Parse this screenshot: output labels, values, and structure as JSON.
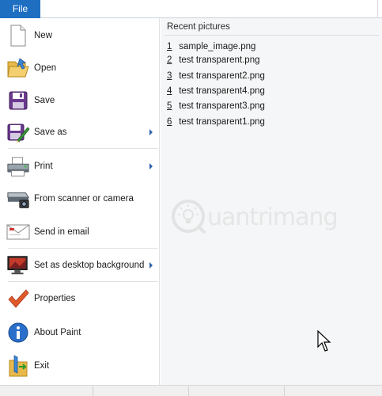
{
  "file_tab": {
    "label": "File"
  },
  "menu": {
    "items": [
      {
        "label": "New",
        "icon": "new-document-icon",
        "has_submenu": false
      },
      {
        "label": "Open",
        "icon": "open-folder-icon",
        "has_submenu": false
      },
      {
        "label": "Save",
        "icon": "floppy-disk-icon",
        "has_submenu": false
      },
      {
        "label": "Save as",
        "icon": "save-as-icon",
        "has_submenu": true
      },
      {
        "label": "Print",
        "icon": "printer-icon",
        "has_submenu": true
      },
      {
        "label": "From scanner or camera",
        "icon": "scanner-camera-icon",
        "has_submenu": false
      },
      {
        "label": "Send in email",
        "icon": "email-icon",
        "has_submenu": false
      },
      {
        "label": "Set as desktop background",
        "icon": "desktop-monitor-icon",
        "has_submenu": true
      },
      {
        "label": "Properties",
        "icon": "checkmark-icon",
        "has_submenu": false
      },
      {
        "label": "About Paint",
        "icon": "info-icon",
        "has_submenu": false
      },
      {
        "label": "Exit",
        "icon": "exit-icon",
        "has_submenu": false
      }
    ]
  },
  "recent": {
    "title": "Recent pictures",
    "items": [
      {
        "num": "1",
        "name": "sample_image.png"
      },
      {
        "num": "2",
        "name": "test transparent.png"
      },
      {
        "num": "3",
        "name": "test transparent2.png"
      },
      {
        "num": "4",
        "name": "test transparent4.png"
      },
      {
        "num": "5",
        "name": "test transparent3.png"
      },
      {
        "num": "6",
        "name": "test transparent1.png"
      }
    ]
  },
  "watermark": {
    "text": "uantrimang"
  },
  "colors": {
    "file_tab": "#1e6fc2",
    "recent_bg": "#f5f6f7",
    "submenu_arrow": "#2a62b0"
  }
}
